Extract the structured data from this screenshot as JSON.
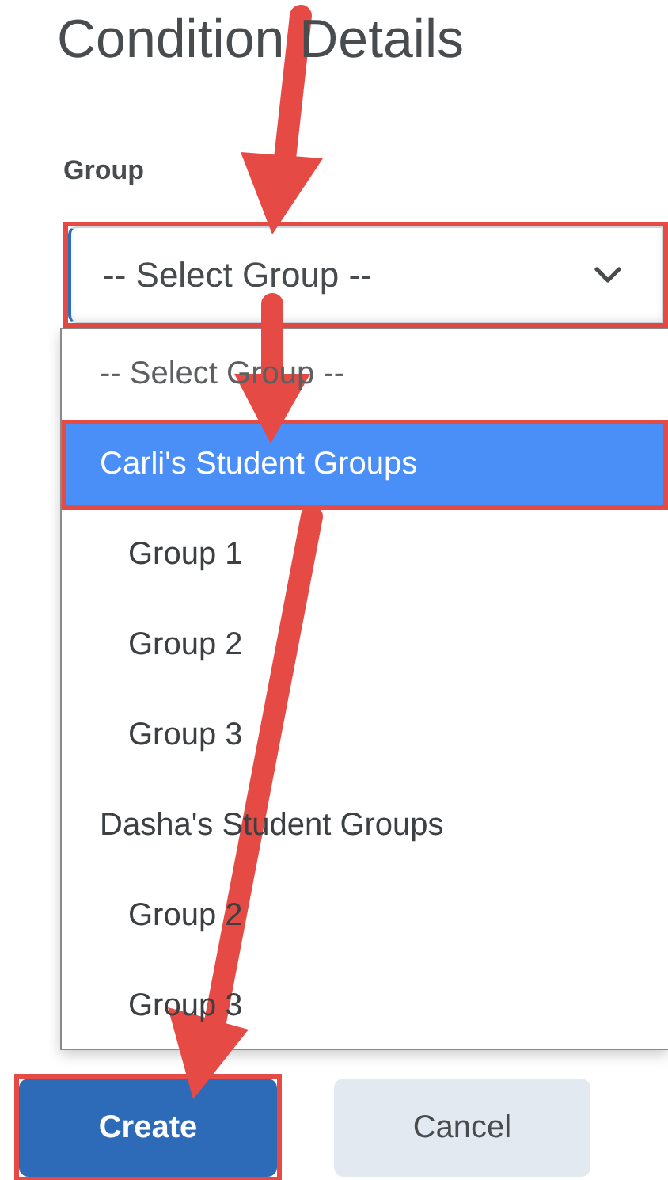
{
  "title": "Condition Details",
  "field": {
    "label": "Group",
    "value": "-- Select Group --",
    "highlighted": true,
    "expanded": true
  },
  "options": [
    {
      "label": "-- Select Group --",
      "selected": false,
      "highlighted": false
    },
    {
      "label": "Carli's Student Groups",
      "selected": true,
      "highlighted": true,
      "children": [
        {
          "label": "Group 1",
          "selected": false
        },
        {
          "label": "Group 2",
          "selected": false
        },
        {
          "label": "Group 3",
          "selected": false
        }
      ]
    },
    {
      "label": "Dasha's Student Groups",
      "selected": false,
      "highlighted": false,
      "children": [
        {
          "label": "Group 2",
          "selected": false
        },
        {
          "label": "Group 3",
          "selected": false
        }
      ]
    }
  ],
  "buttons": [
    {
      "label": "Create",
      "kind": "primary",
      "highlighted": true
    },
    {
      "label": "Cancel",
      "kind": "secondary",
      "highlighted": false
    }
  ]
}
